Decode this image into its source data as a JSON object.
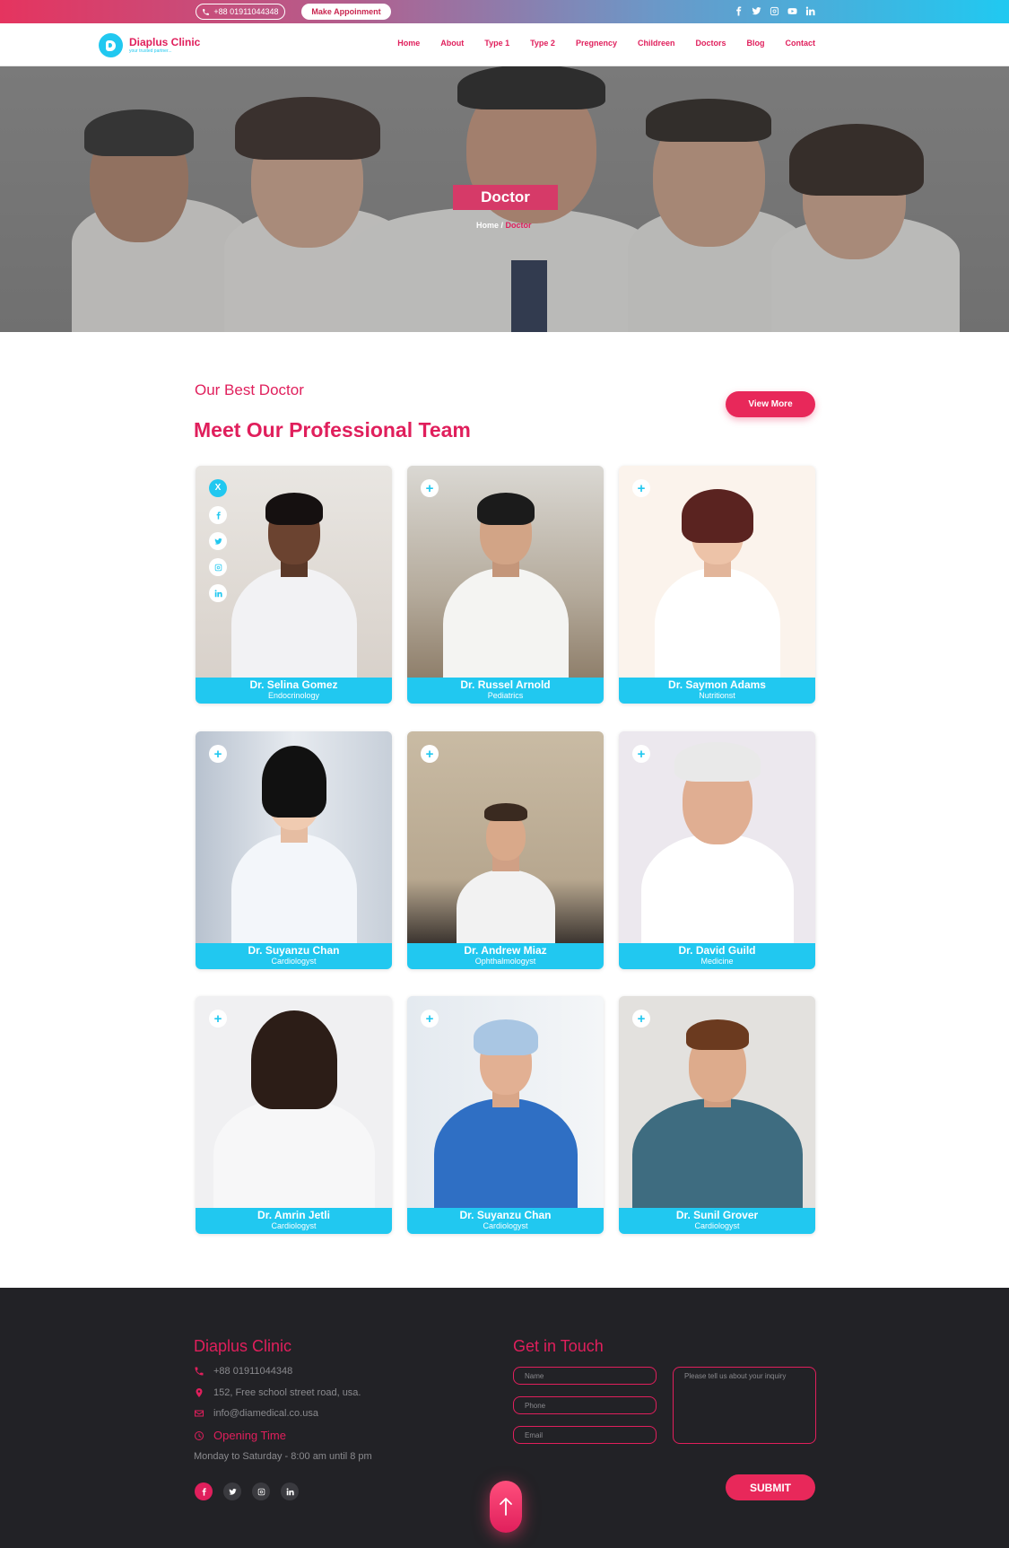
{
  "topbar": {
    "phone": "+88 01911044348",
    "appointment_label": "Make Appoinment",
    "social_icons": [
      "facebook-icon",
      "twitter-icon",
      "instagram-icon",
      "youtube-icon",
      "linkedin-icon"
    ]
  },
  "nav": {
    "brand": "Diaplus Clinic",
    "tagline": "your trusted partner...",
    "items": [
      "Home",
      "About",
      "Type 1",
      "Type 2",
      "Pregnency",
      "Childreen",
      "Doctors",
      "Blog",
      "Contact"
    ]
  },
  "hero": {
    "title": "Doctor",
    "breadcrumb_home": "Home /",
    "breadcrumb_current": "Doctor"
  },
  "team": {
    "subtitle": "Our Best Doctor",
    "title": "Meet Our Professional Team",
    "view_more": "View More",
    "doctors": [
      {
        "name": "Dr. Selina Gomez",
        "specialty": "Endocrinology"
      },
      {
        "name": "Dr. Russel Arnold",
        "specialty": "Pediatrics"
      },
      {
        "name": "Dr. Saymon Adams",
        "specialty": "Nutritionst"
      },
      {
        "name": "Dr. Suyanzu Chan",
        "specialty": "Cardiologyst"
      },
      {
        "name": "Dr. Andrew Miaz",
        "specialty": "Ophthalmologyst"
      },
      {
        "name": "Dr. David Guild",
        "specialty": "Medicine"
      },
      {
        "name": "Dr. Amrin Jetli",
        "specialty": "Cardiologyst"
      },
      {
        "name": "Dr. Suyanzu Chan",
        "specialty": "Cardiologyst"
      },
      {
        "name": "Dr. Sunil Grover",
        "specialty": "Cardiologyst"
      }
    ],
    "expanded_close": "X"
  },
  "footer": {
    "brand": "Diaplus Clinic",
    "phone": "+88 01911044348",
    "address": "152, Free school street road, usa.",
    "email": "info@diamedical.co.usa",
    "opening_label": "Opening Time",
    "hours": "Monday to Saturday - 8:00 am until 8 pm",
    "touch_title": "Get in Touch",
    "name_placeholder": "Name",
    "phone_placeholder": "Phone",
    "email_placeholder": "Email",
    "message_placeholder": "Please tell us about your inquiry",
    "submit_label": "SUBMIT"
  },
  "colors": {
    "accent": "#e01f5c",
    "cyan": "#21c8f0",
    "footer_bg": "#222226"
  }
}
